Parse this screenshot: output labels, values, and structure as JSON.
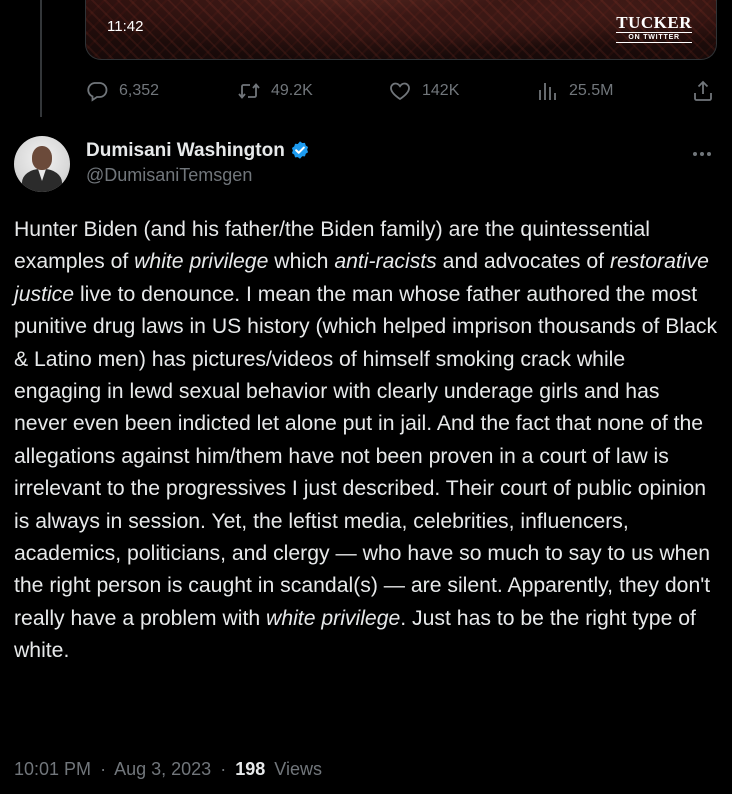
{
  "media": {
    "duration": "11:42",
    "watermark_main": "TUCKER",
    "watermark_sub": "ON TWITTER"
  },
  "parent_actions": {
    "replies": "6,352",
    "retweets": "49.2K",
    "likes": "142K",
    "views": "25.5M"
  },
  "tweet": {
    "display_name": "Dumisani Washington",
    "handle": "@DumisaniTemsgen",
    "verified_color": "#1d9bf0",
    "body": [
      {
        "t": "Hunter Biden (and his father/the Biden family) are the quintessential examples of "
      },
      {
        "t": "white privilege",
        "i": true
      },
      {
        "t": " which "
      },
      {
        "t": "anti-racists",
        "i": true
      },
      {
        "t": " and advocates of "
      },
      {
        "t": "restorative justice",
        "i": true
      },
      {
        "t": " live to denounce. I mean the man whose father authored the most punitive drug laws in US history (which helped imprison thousands of Black & Latino men) has pictures/videos of himself smoking crack while engaging in lewd sexual behavior with clearly underage girls and has never even been indicted let alone put in jail. And the fact that none of the allegations against him/them have not been proven in a court of law is irrelevant to the progressives I just described. Their court of public opinion is always in session. Yet, the leftist media, celebrities, influencers, academics, politicians, and clergy — who have so much to say to us when the right person is caught in scandal(s) — are silent. Apparently, they don't really have a problem with "
      },
      {
        "t": "white privilege",
        "i": true
      },
      {
        "t": ". Just has to be the right type of white."
      }
    ],
    "time": "10:01 PM",
    "date": "Aug 3, 2023",
    "separator": "·",
    "views_count": "198",
    "views_label": "Views"
  },
  "colors": {
    "background": "#000000",
    "text": "#e7e9ea",
    "muted": "#71767b"
  },
  "icons": [
    "reply-icon",
    "retweet-icon",
    "like-icon",
    "views-icon",
    "share-icon",
    "verified-icon",
    "more-icon"
  ]
}
